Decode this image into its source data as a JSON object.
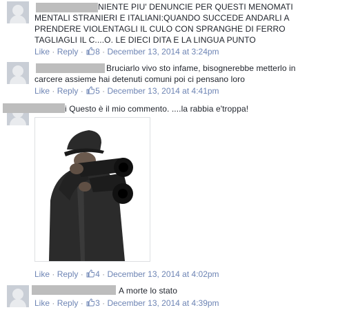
{
  "comments": [
    {
      "lines": [
        "NIENTE PIU' DENUNCIE PER QUESTI MENOMATI",
        "MENTALI STRANIERI E ITALIANI:QUANDO SUCCEDE ANDARLI A",
        "PRENDERE VIOLENTAGLI IL CULO CON SPRANGHE DI FERRO",
        "TAGLIAGLI IL C....O. LE DIECI DITA E LA LINGUA PUNTO"
      ],
      "like": "Like",
      "reply": "Reply",
      "likes": "8",
      "time": "December 13, 2014 at 3:24pm"
    },
    {
      "lines": [
        "Bruciarlo vivo sto infame, bisognerebbe metterlo in",
        "carcere assieme hai detenuti comuni poi ci pensano loro"
      ],
      "like": "Like",
      "reply": "Reply",
      "likes": "5",
      "time": "December 13, 2014 at 4:41pm"
    },
    {
      "lines": [
        "i Questo è il mio commento. ....la rabbia e'troppa!"
      ],
      "like": "Like",
      "reply": "Reply",
      "likes": "4",
      "time": "December 13, 2014 at 4:02pm"
    },
    {
      "lines": [
        "A morte lo stato"
      ],
      "like": "Like",
      "reply": "Reply",
      "likes": "3",
      "time": "December 13, 2014 at 4:39pm"
    }
  ],
  "separator": "·",
  "colors": {
    "link": "#6d84b4",
    "text": "#1d2129",
    "redaction": "#bdbdbd"
  },
  "icons": {
    "like": "thumbs-up-icon",
    "avatar": "user-avatar-icon"
  }
}
